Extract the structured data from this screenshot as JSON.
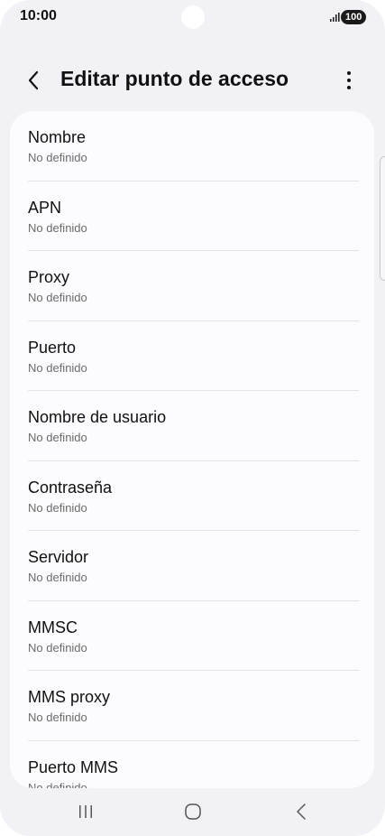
{
  "status_bar": {
    "time": "10:00",
    "battery": "100",
    "signal_icon": "signal-bars-icon"
  },
  "header": {
    "title": "Editar punto de acceso",
    "back_icon": "chevron-left-icon",
    "more_icon": "more-vertical-icon"
  },
  "items": [
    {
      "title": "Nombre",
      "value": "No definido"
    },
    {
      "title": "APN",
      "value": "No definido"
    },
    {
      "title": "Proxy",
      "value": "No definido"
    },
    {
      "title": "Puerto",
      "value": "No definido"
    },
    {
      "title": "Nombre de usuario",
      "value": "No definido"
    },
    {
      "title": "Contraseña",
      "value": "No definido"
    },
    {
      "title": "Servidor",
      "value": "No definido"
    },
    {
      "title": "MMSC",
      "value": "No definido"
    },
    {
      "title": "MMS proxy",
      "value": "No definido"
    },
    {
      "title": "Puerto MMS",
      "value": "No definido"
    }
  ],
  "nav_bar": {
    "recents_icon": "recents-icon",
    "home_icon": "home-icon",
    "back_icon": "back-icon"
  },
  "colors": {
    "background": "#f2f2f6",
    "card": "#fcfcfe",
    "text_primary": "#111111",
    "text_secondary": "#6b6b6b"
  }
}
